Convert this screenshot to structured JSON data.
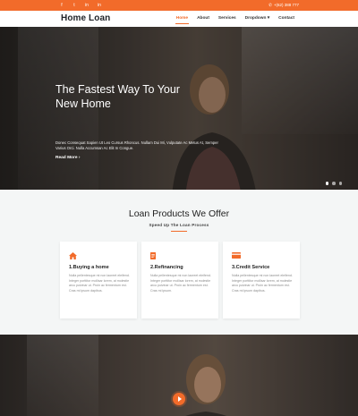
{
  "topbar": {
    "socials": [
      "f",
      "t",
      "in",
      "in"
    ],
    "phone": "+(62) 388 777"
  },
  "nav": {
    "brand": "Home Loan",
    "items": [
      {
        "label": "Home"
      },
      {
        "label": "About"
      },
      {
        "label": "Services"
      },
      {
        "label": "Dropdown ▾"
      },
      {
        "label": "Contact"
      }
    ]
  },
  "hero": {
    "title_line1": "The Fastest Way To Your",
    "title_line2": "New Home",
    "text": "Donec Consequat Sapien Ut Leo Cursus Rhoncus. Nullam Dui Mi, Vulputate Ac Metus At, Semper Varius Orci. Nulla Accumsan Ac Elit In Congue.",
    "more": "Read More ›"
  },
  "products": {
    "title": "Loan Products We Offer",
    "subtitle": "Speed Up The Loan Process",
    "cards": [
      {
        "icon": "home-icon",
        "title": "1.Buying a home",
        "body": "Nulla pellentesque mi non laoreet eleifend. Integer porttitor mollisar lorem, at molestie arcu pulvinar ut. Proin ac fermentum est. Cras mi ipsum dapibus."
      },
      {
        "icon": "document-icon",
        "title": "2.Refinancing",
        "body": "Nulla pellentesque mi non laoreet eleifend. Integer porttitor mollisar lorem, at molestie arcu pulvinar ut. Proin ac fermentum est. Cras mi ipsum."
      },
      {
        "icon": "credit-card-icon",
        "title": "3.Credit Service",
        "body": "Nulla pellentesque mi non laoreet eleifend. Integer porttitor mollisar lorem, at molestie arcu pulvinar ut. Proin ac fermentum est. Cras mi ipsum dapibus."
      }
    ]
  },
  "colors": {
    "accent": "#f26b2a"
  }
}
